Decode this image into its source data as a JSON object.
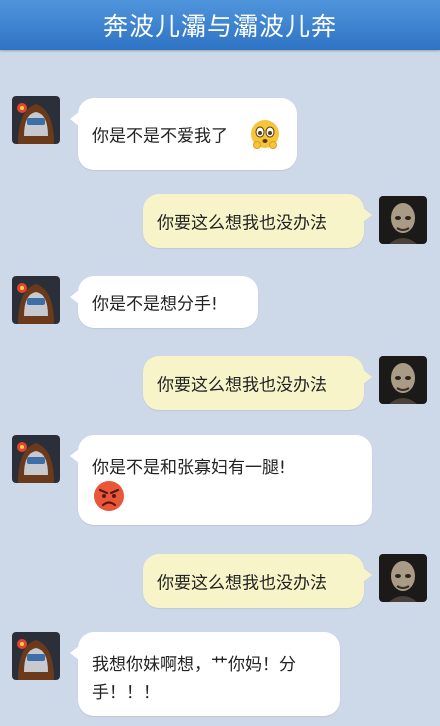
{
  "header": {
    "title": "奔波儿灞与灞波儿奔"
  },
  "colors": {
    "header": "#3a84d2",
    "background": "#cdd8e8",
    "bubble_left": "#ffffff",
    "bubble_right": "#f6f4c8"
  },
  "messages": [
    {
      "side": "left",
      "text": "你是不是不爱我了",
      "emoji": "worried-face-icon"
    },
    {
      "side": "right",
      "text": "你要这么想我也没办法"
    },
    {
      "side": "left",
      "text": "你是不是想分手!"
    },
    {
      "side": "right",
      "text": "你要这么想我也没办法"
    },
    {
      "side": "left",
      "text": "你是不是和张寡妇有一腿!",
      "emoji": "angry-face-icon"
    },
    {
      "side": "right",
      "text": "你要这么想我也没办法"
    },
    {
      "side": "left",
      "line1": "我想你妹啊想，艹你妈！分",
      "line2": "手！！！"
    }
  ]
}
